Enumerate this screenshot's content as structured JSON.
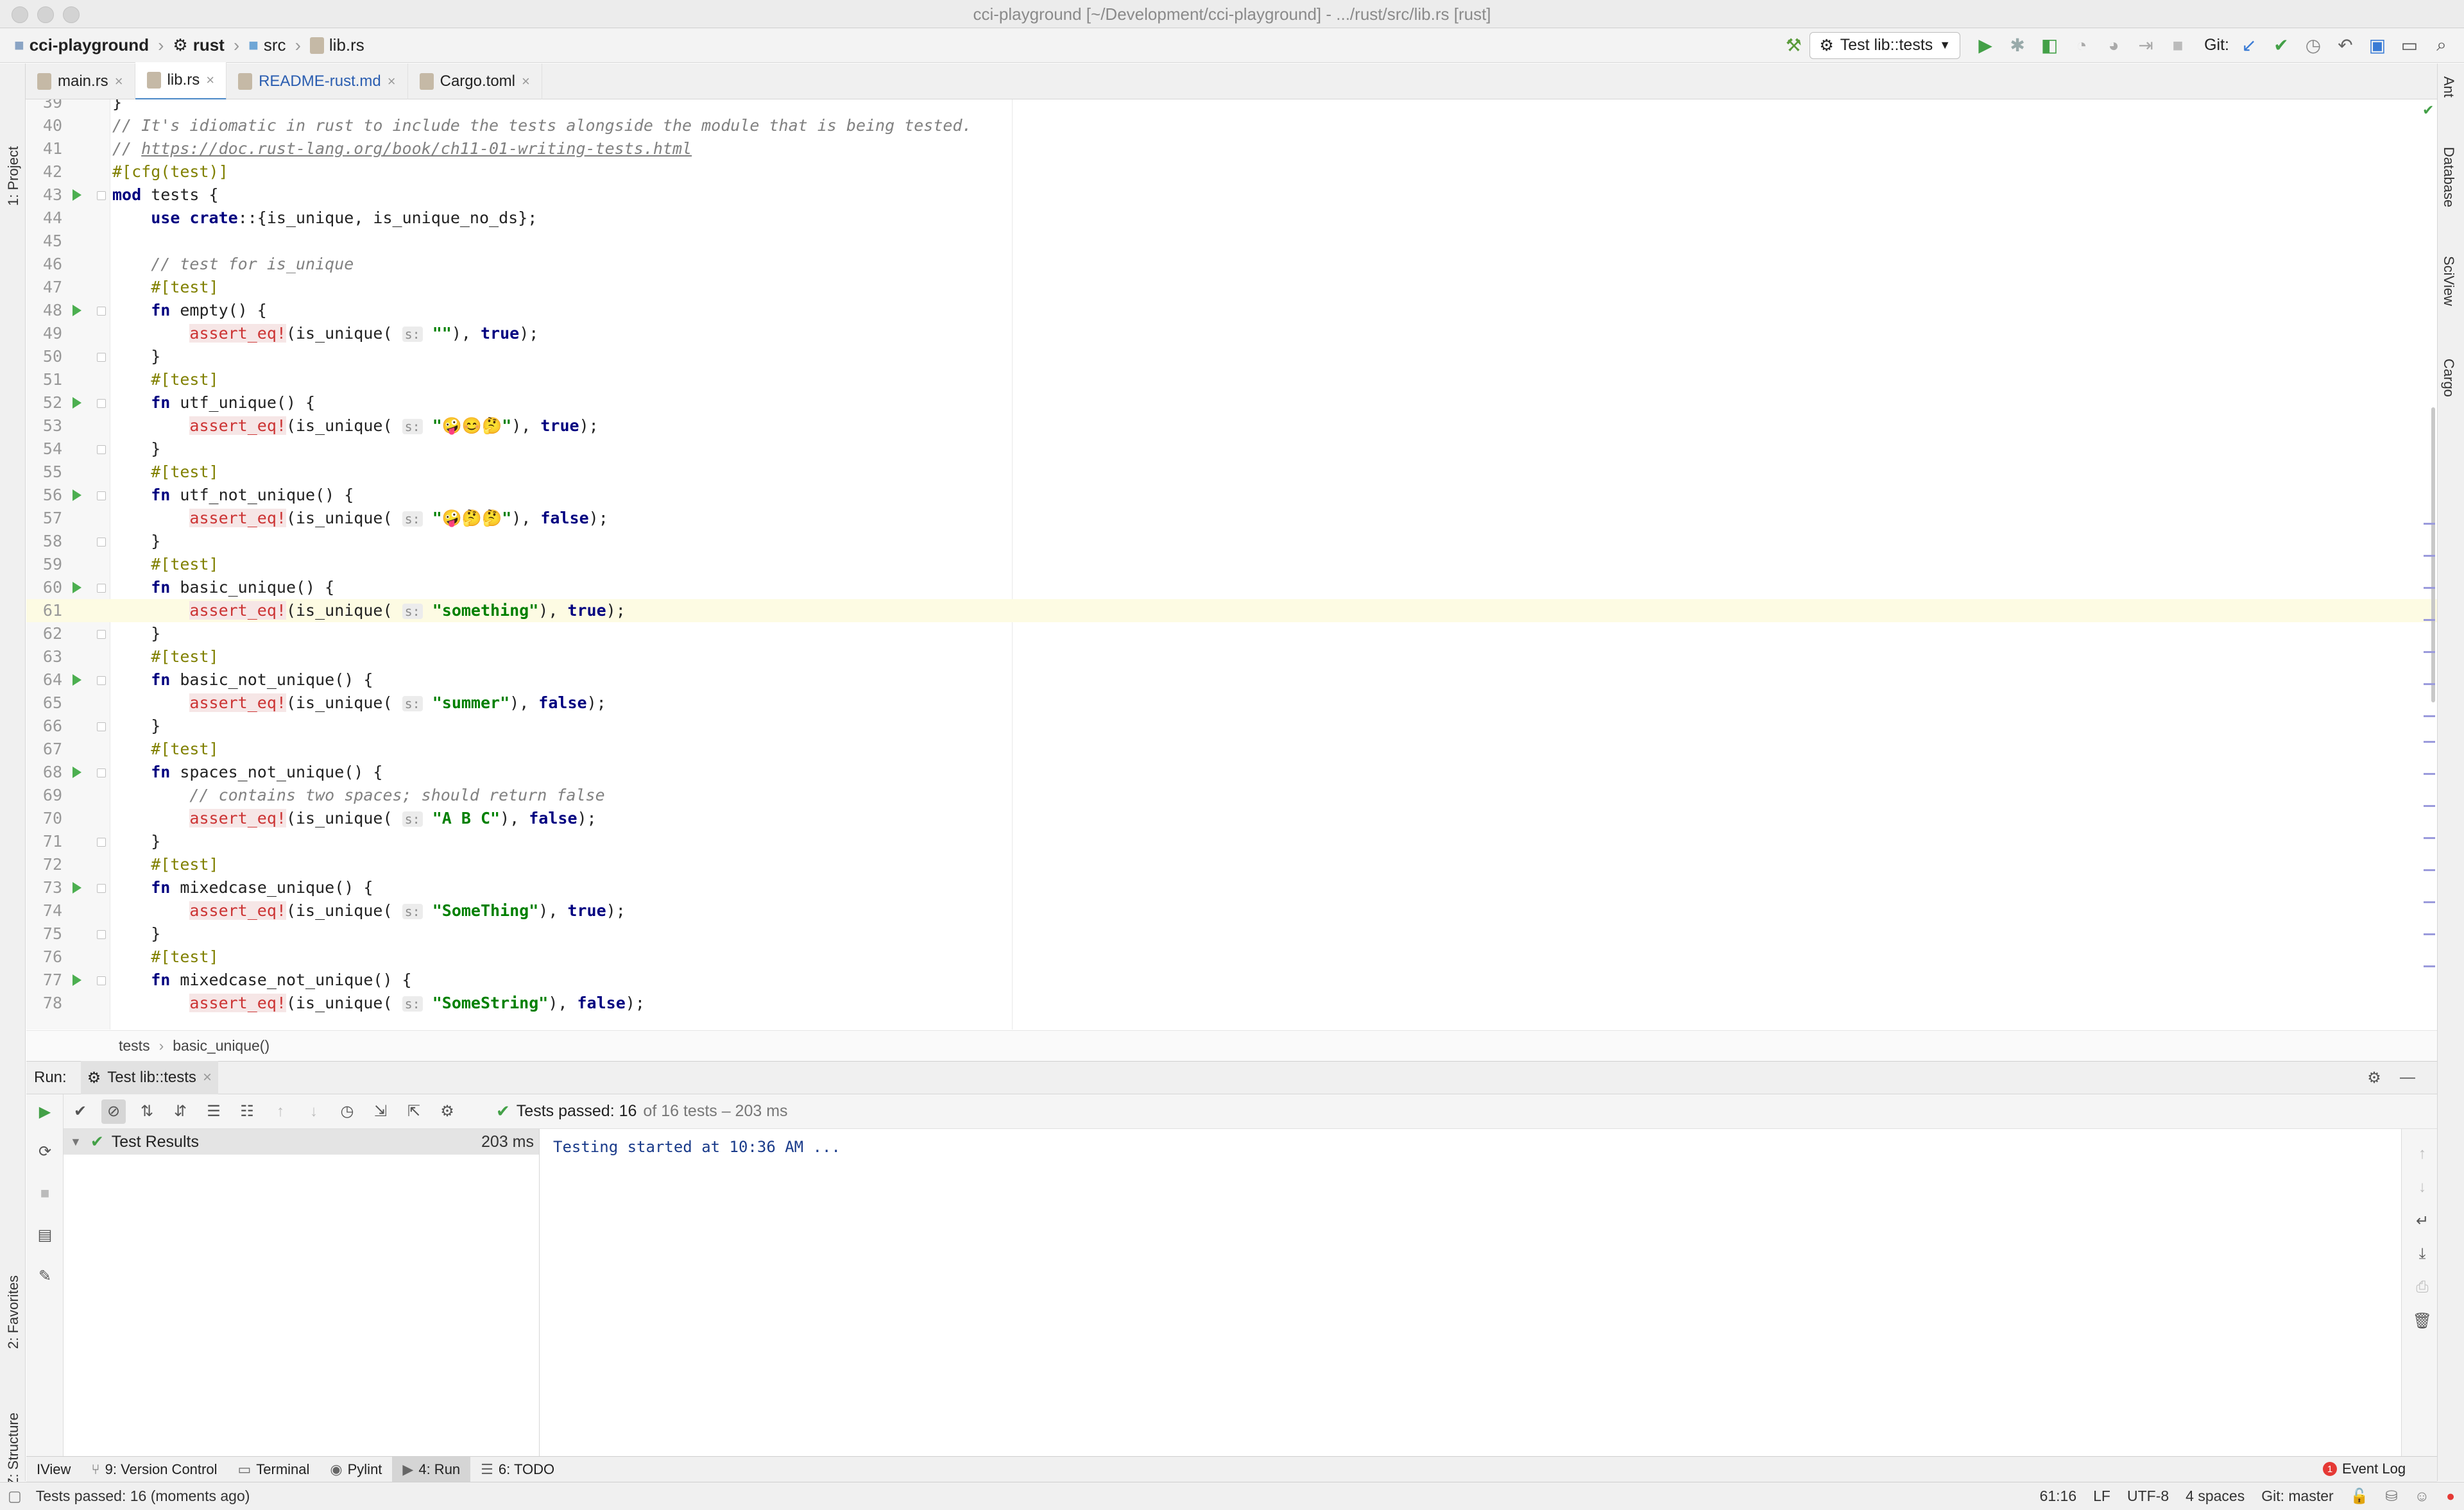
{
  "window": {
    "title": "cci-playground [~/Development/cci-playground] - .../rust/src/lib.rs [rust]"
  },
  "breadcrumb": [
    "cci-playground",
    "rust",
    "src",
    "lib.rs"
  ],
  "toolbar": {
    "run_config": "Test lib::tests",
    "git_label": "Git:"
  },
  "editor_tabs": [
    {
      "label": "main.rs",
      "active": false
    },
    {
      "label": "lib.rs",
      "active": true
    },
    {
      "label": "README-rust.md",
      "active": false
    },
    {
      "label": "Cargo.toml",
      "active": false
    }
  ],
  "left_tools": {
    "project": "1: Project",
    "favorites": "2: Favorites",
    "structure": "Z: Structure"
  },
  "right_tools": {
    "ant": "Ant",
    "database": "Database",
    "sciview": "SciView",
    "cargo": "Cargo"
  },
  "editor": {
    "lines": [
      {
        "n": "39",
        "run": false,
        "fold": false,
        "cur": false,
        "t": [
          [
            "",
            "}"
          ]
        ]
      },
      {
        "n": "40",
        "run": false,
        "fold": false,
        "cur": false,
        "t": [
          [
            "cmt",
            "// It's idiomatic in rust to include the tests alongside the module that is being tested."
          ]
        ]
      },
      {
        "n": "41",
        "run": false,
        "fold": false,
        "cur": false,
        "t": [
          [
            "cmt",
            "// "
          ],
          [
            "link",
            "https://doc.rust-lang.org/book/ch11-01-writing-tests.html"
          ]
        ]
      },
      {
        "n": "42",
        "run": false,
        "fold": false,
        "cur": false,
        "t": [
          [
            "attr",
            "#[cfg(test)]"
          ]
        ]
      },
      {
        "n": "43",
        "run": true,
        "fold": true,
        "cur": false,
        "t": [
          [
            "kw",
            "mod"
          ],
          [
            "",
            " tests {"
          ]
        ]
      },
      {
        "n": "44",
        "run": false,
        "fold": false,
        "cur": false,
        "t": [
          [
            "",
            "    "
          ],
          [
            "kw",
            "use"
          ],
          [
            "",
            " "
          ],
          [
            "kw",
            "crate"
          ],
          [
            "",
            "::{is_unique, is_unique_no_ds};"
          ]
        ]
      },
      {
        "n": "45",
        "run": false,
        "fold": false,
        "cur": false,
        "t": []
      },
      {
        "n": "46",
        "run": false,
        "fold": false,
        "cur": false,
        "t": [
          [
            "",
            "    "
          ],
          [
            "cmt",
            "// test for is_unique"
          ]
        ]
      },
      {
        "n": "47",
        "run": false,
        "fold": false,
        "cur": false,
        "t": [
          [
            "",
            "    "
          ],
          [
            "attr",
            "#[test]"
          ]
        ]
      },
      {
        "n": "48",
        "run": true,
        "fold": true,
        "cur": false,
        "t": [
          [
            "",
            "    "
          ],
          [
            "kw",
            "fn"
          ],
          [
            "",
            " empty() {"
          ]
        ]
      },
      {
        "n": "49",
        "run": false,
        "fold": false,
        "cur": false,
        "t": [
          [
            "",
            "        "
          ],
          [
            "mac",
            "assert_eq!"
          ],
          [
            "",
            "(is_unique( "
          ],
          [
            "hint",
            "s:"
          ],
          [
            "",
            " "
          ],
          [
            "str",
            "\"\""
          ],
          [
            "",
            "), "
          ],
          [
            "kw",
            "true"
          ],
          [
            "",
            ");"
          ]
        ]
      },
      {
        "n": "50",
        "run": false,
        "fold": true,
        "cur": false,
        "t": [
          [
            "",
            "    }"
          ]
        ]
      },
      {
        "n": "51",
        "run": false,
        "fold": false,
        "cur": false,
        "t": [
          [
            "",
            "    "
          ],
          [
            "attr",
            "#[test]"
          ]
        ]
      },
      {
        "n": "52",
        "run": true,
        "fold": true,
        "cur": false,
        "t": [
          [
            "",
            "    "
          ],
          [
            "kw",
            "fn"
          ],
          [
            "",
            " utf_unique() {"
          ]
        ]
      },
      {
        "n": "53",
        "run": false,
        "fold": false,
        "cur": false,
        "t": [
          [
            "",
            "        "
          ],
          [
            "mac",
            "assert_eq!"
          ],
          [
            "",
            "(is_unique( "
          ],
          [
            "hint",
            "s:"
          ],
          [
            "",
            " "
          ],
          [
            "str",
            "\"🤪😊🤔\""
          ],
          [
            "",
            "), "
          ],
          [
            "kw",
            "true"
          ],
          [
            "",
            ");"
          ]
        ]
      },
      {
        "n": "54",
        "run": false,
        "fold": true,
        "cur": false,
        "t": [
          [
            "",
            "    }"
          ]
        ]
      },
      {
        "n": "55",
        "run": false,
        "fold": false,
        "cur": false,
        "t": [
          [
            "",
            "    "
          ],
          [
            "attr",
            "#[test]"
          ]
        ]
      },
      {
        "n": "56",
        "run": true,
        "fold": true,
        "cur": false,
        "t": [
          [
            "",
            "    "
          ],
          [
            "kw",
            "fn"
          ],
          [
            "",
            " utf_not_unique() {"
          ]
        ]
      },
      {
        "n": "57",
        "run": false,
        "fold": false,
        "cur": false,
        "t": [
          [
            "",
            "        "
          ],
          [
            "mac",
            "assert_eq!"
          ],
          [
            "",
            "(is_unique( "
          ],
          [
            "hint",
            "s:"
          ],
          [
            "",
            " "
          ],
          [
            "str",
            "\"🤪🤔🤔\""
          ],
          [
            "",
            "), "
          ],
          [
            "kw",
            "false"
          ],
          [
            "",
            ");"
          ]
        ]
      },
      {
        "n": "58",
        "run": false,
        "fold": true,
        "cur": false,
        "t": [
          [
            "",
            "    }"
          ]
        ]
      },
      {
        "n": "59",
        "run": false,
        "fold": false,
        "cur": false,
        "t": [
          [
            "",
            "    "
          ],
          [
            "attr",
            "#[test]"
          ]
        ]
      },
      {
        "n": "60",
        "run": true,
        "fold": true,
        "cur": false,
        "t": [
          [
            "",
            "    "
          ],
          [
            "kw",
            "fn"
          ],
          [
            "",
            " basic_unique() {"
          ]
        ]
      },
      {
        "n": "61",
        "run": false,
        "fold": false,
        "cur": true,
        "t": [
          [
            "",
            "        "
          ],
          [
            "mac",
            "assert_eq!"
          ],
          [
            "",
            "(is_unique( "
          ],
          [
            "hint",
            "s:"
          ],
          [
            "",
            " "
          ],
          [
            "str",
            "\"something\""
          ],
          [
            "",
            "), "
          ],
          [
            "kw",
            "true"
          ],
          [
            "",
            ");"
          ]
        ]
      },
      {
        "n": "62",
        "run": false,
        "fold": true,
        "cur": false,
        "t": [
          [
            "",
            "    }"
          ]
        ]
      },
      {
        "n": "63",
        "run": false,
        "fold": false,
        "cur": false,
        "t": [
          [
            "",
            "    "
          ],
          [
            "attr",
            "#[test]"
          ]
        ]
      },
      {
        "n": "64",
        "run": true,
        "fold": true,
        "cur": false,
        "t": [
          [
            "",
            "    "
          ],
          [
            "kw",
            "fn"
          ],
          [
            "",
            " basic_not_unique() {"
          ]
        ]
      },
      {
        "n": "65",
        "run": false,
        "fold": false,
        "cur": false,
        "t": [
          [
            "",
            "        "
          ],
          [
            "mac",
            "assert_eq!"
          ],
          [
            "",
            "(is_unique( "
          ],
          [
            "hint",
            "s:"
          ],
          [
            "",
            " "
          ],
          [
            "str",
            "\"summer\""
          ],
          [
            "",
            "), "
          ],
          [
            "kw",
            "false"
          ],
          [
            "",
            ");"
          ]
        ]
      },
      {
        "n": "66",
        "run": false,
        "fold": true,
        "cur": false,
        "t": [
          [
            "",
            "    }"
          ]
        ]
      },
      {
        "n": "67",
        "run": false,
        "fold": false,
        "cur": false,
        "t": [
          [
            "",
            "    "
          ],
          [
            "attr",
            "#[test]"
          ]
        ]
      },
      {
        "n": "68",
        "run": true,
        "fold": true,
        "cur": false,
        "t": [
          [
            "",
            "    "
          ],
          [
            "kw",
            "fn"
          ],
          [
            "",
            " spaces_not_unique() {"
          ]
        ]
      },
      {
        "n": "69",
        "run": false,
        "fold": false,
        "cur": false,
        "t": [
          [
            "",
            "        "
          ],
          [
            "cmt",
            "// contains two spaces; should return false"
          ]
        ]
      },
      {
        "n": "70",
        "run": false,
        "fold": false,
        "cur": false,
        "t": [
          [
            "",
            "        "
          ],
          [
            "mac",
            "assert_eq!"
          ],
          [
            "",
            "(is_unique( "
          ],
          [
            "hint",
            "s:"
          ],
          [
            "",
            " "
          ],
          [
            "str",
            "\"A B C\""
          ],
          [
            "",
            "), "
          ],
          [
            "kw",
            "false"
          ],
          [
            "",
            ");"
          ]
        ]
      },
      {
        "n": "71",
        "run": false,
        "fold": true,
        "cur": false,
        "t": [
          [
            "",
            "    }"
          ]
        ]
      },
      {
        "n": "72",
        "run": false,
        "fold": false,
        "cur": false,
        "t": [
          [
            "",
            "    "
          ],
          [
            "attr",
            "#[test]"
          ]
        ]
      },
      {
        "n": "73",
        "run": true,
        "fold": true,
        "cur": false,
        "t": [
          [
            "",
            "    "
          ],
          [
            "kw",
            "fn"
          ],
          [
            "",
            " mixedcase_unique() {"
          ]
        ]
      },
      {
        "n": "74",
        "run": false,
        "fold": false,
        "cur": false,
        "t": [
          [
            "",
            "        "
          ],
          [
            "mac",
            "assert_eq!"
          ],
          [
            "",
            "(is_unique( "
          ],
          [
            "hint",
            "s:"
          ],
          [
            "",
            " "
          ],
          [
            "str",
            "\"SomeThing\""
          ],
          [
            "",
            "), "
          ],
          [
            "kw",
            "true"
          ],
          [
            "",
            ");"
          ]
        ]
      },
      {
        "n": "75",
        "run": false,
        "fold": true,
        "cur": false,
        "t": [
          [
            "",
            "    }"
          ]
        ]
      },
      {
        "n": "76",
        "run": false,
        "fold": false,
        "cur": false,
        "t": [
          [
            "",
            "    "
          ],
          [
            "attr",
            "#[test]"
          ]
        ]
      },
      {
        "n": "77",
        "run": true,
        "fold": true,
        "cur": false,
        "t": [
          [
            "",
            "    "
          ],
          [
            "kw",
            "fn"
          ],
          [
            "",
            " mixedcase_not_unique() {"
          ]
        ]
      },
      {
        "n": "78",
        "run": false,
        "fold": false,
        "cur": false,
        "t": [
          [
            "",
            "        "
          ],
          [
            "mac",
            "assert_eq!"
          ],
          [
            "",
            "(is_unique( "
          ],
          [
            "hint",
            "s:"
          ],
          [
            "",
            " "
          ],
          [
            "str",
            "\"SomeString\""
          ],
          [
            "",
            "), "
          ],
          [
            "kw",
            "false"
          ],
          [
            "",
            ");"
          ]
        ]
      }
    ]
  },
  "editor_breadcrumb": {
    "a": "tests",
    "sep": "›",
    "b": "basic_unique()"
  },
  "run_panel": {
    "label": "Run:",
    "tab": "Test lib::tests",
    "status_main": "Tests passed: 16",
    "status_rest": "of 16 tests – 203 ms",
    "tree_root": "Test Results",
    "tree_time": "203 ms",
    "console": "Testing started at 10:36 AM ..."
  },
  "bottom_tabs": [
    {
      "label": "IView",
      "active": false
    },
    {
      "label": "9: Version Control",
      "active": false
    },
    {
      "label": "Terminal",
      "active": false
    },
    {
      "label": "Pylint",
      "active": false
    },
    {
      "label": "4: Run",
      "active": true
    },
    {
      "label": "6: TODO",
      "active": false
    }
  ],
  "event_log": "Event Log",
  "status": {
    "message": "Tests passed: 16 (moments ago)",
    "position": "61:16",
    "line_sep": "LF",
    "encoding": "UTF-8",
    "indent": "4 spaces",
    "git": "Git: master",
    "errors": "1"
  }
}
